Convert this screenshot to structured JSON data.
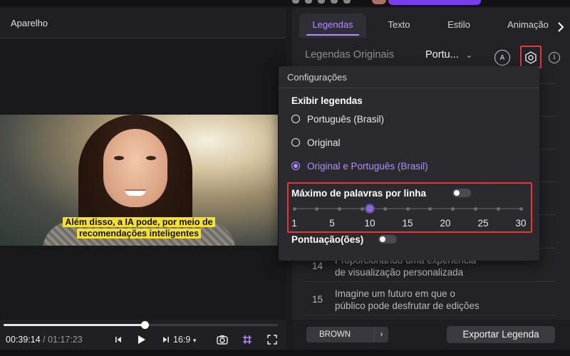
{
  "player": {
    "title": "Aparelho",
    "caption_line1": "Além disso, a IA pode, por meio de",
    "caption_line2": "recomendações inteligentes",
    "current_time": "00:39:14",
    "separator": " / ",
    "total_time": "01:17:23",
    "progress_fraction": 0.514,
    "aspect_ratio": "16:9",
    "icons": [
      "prev-frame-icon",
      "play-icon",
      "next-frame-icon",
      "chevron-down-icon",
      "camera-icon",
      "grid-icon",
      "fullscreen-icon"
    ]
  },
  "tabs": [
    {
      "label": "Legendas",
      "active": true
    },
    {
      "label": "Texto",
      "active": false
    },
    {
      "label": "Estilo",
      "active": false
    },
    {
      "label": "Animação",
      "active": false
    }
  ],
  "subtitle_panel": {
    "original_label": "Legendas Originais",
    "language": "Portu...",
    "ai_icon_text": "A"
  },
  "dropdown": {
    "title": "Configurações",
    "section_label": "Exibir legendas",
    "options": [
      {
        "label": "Português (Brasil)",
        "selected": false
      },
      {
        "label": "Original",
        "selected": false
      },
      {
        "label": "Original e Português (Brasil)",
        "selected": true
      }
    ],
    "max_words_label": "Máximo de palavras por linha",
    "max_words_enabled": false,
    "slider_ticks": [
      "1",
      "5",
      "10",
      "15",
      "20",
      "25",
      "30"
    ],
    "slider_value": 10,
    "punctuation_label": "Pontuação(ões)",
    "punctuation_enabled": false
  },
  "subtitles": [
    {
      "num": "14",
      "line1": "Proporcionando uma experiência",
      "line2": "de visualização personalizada"
    },
    {
      "num": "15",
      "line1": "Imagine um futuro em que o",
      "line2": "público pode desfrutar de edições"
    }
  ],
  "footer": {
    "style_label": "BROWN",
    "export_label": "Exportar Legenda"
  },
  "colors": {
    "accent": "#b58cff",
    "highlight": "#e5383b",
    "caption_bg": "#f5e12a"
  }
}
